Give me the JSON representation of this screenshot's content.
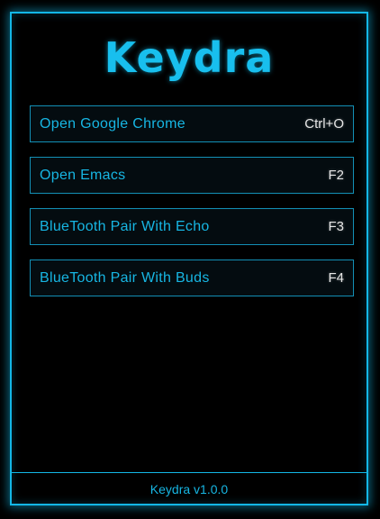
{
  "app": {
    "title": "Keydra",
    "version_label": "Keydra v1.0.0"
  },
  "shortcuts": [
    {
      "label": "Open Google Chrome",
      "key": "Ctrl+O"
    },
    {
      "label": "Open Emacs",
      "key": "F2"
    },
    {
      "label": "BlueTooth Pair With Echo",
      "key": "F3"
    },
    {
      "label": "BlueTooth Pair With Buds",
      "key": "F4"
    }
  ],
  "colors": {
    "accent": "#18bfee",
    "background": "#000000",
    "key_text": "#e6e6e6"
  }
}
